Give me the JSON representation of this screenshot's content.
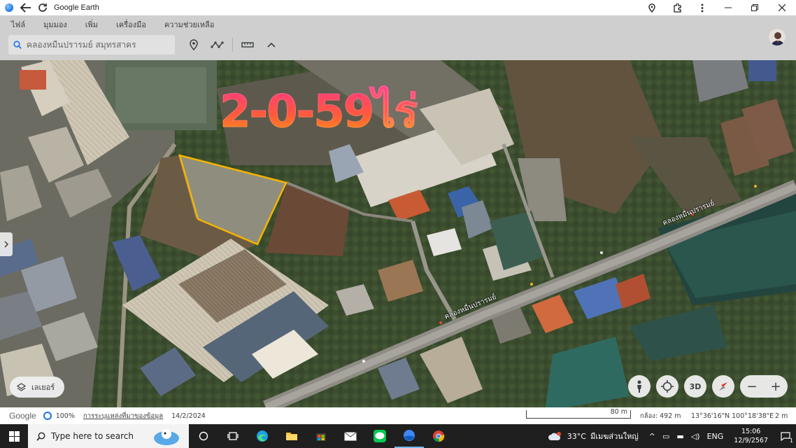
{
  "window": {
    "title": "Google Earth",
    "icons": [
      "back-arrow-icon",
      "reload-icon",
      "location-pin-icon",
      "extension-icon",
      "more-vertical-icon",
      "minimize-icon",
      "restore-icon",
      "close-icon"
    ]
  },
  "menu": {
    "items": [
      {
        "label": "ไฟล์"
      },
      {
        "label": "มุมมอง"
      },
      {
        "label": "เพิ่ม"
      },
      {
        "label": "เครื่องมือ"
      },
      {
        "label": "ความช่วยเหลือ"
      }
    ]
  },
  "search": {
    "placeholder": "คลองหมื่นปรารมย์ สมุทรสาคร"
  },
  "map": {
    "area_label": "2-0-59ไร่",
    "road_labels": [
      {
        "text": "คลองหมื่นปรารมย์"
      },
      {
        "text": "คลองหมื่นปรารมย์"
      }
    ],
    "outline_color": "#f5b300"
  },
  "controls": {
    "layers_label": "เลเยอร์",
    "view_3d_label": "3D",
    "zoom_out": "−",
    "zoom_in": "+"
  },
  "status": {
    "logo": "Google",
    "zoom_percent": "100%",
    "data_source_link": "การระบุแหล่งที่มาของข้อมูล",
    "imagery_date": "14/2/2024",
    "scale": "80 m",
    "camera": "กล้อง: 492 m",
    "coordinates": "13°36'16\"N 100°18'38\"E",
    "elevation": "2 m"
  },
  "taskbar": {
    "search_placeholder": "Type here to search",
    "weather": "33°C",
    "weather_desc": "มีเมฆส่วนใหญ่",
    "language": "ENG",
    "time": "15:06",
    "date": "12/9/2567",
    "notification_count": "1"
  }
}
